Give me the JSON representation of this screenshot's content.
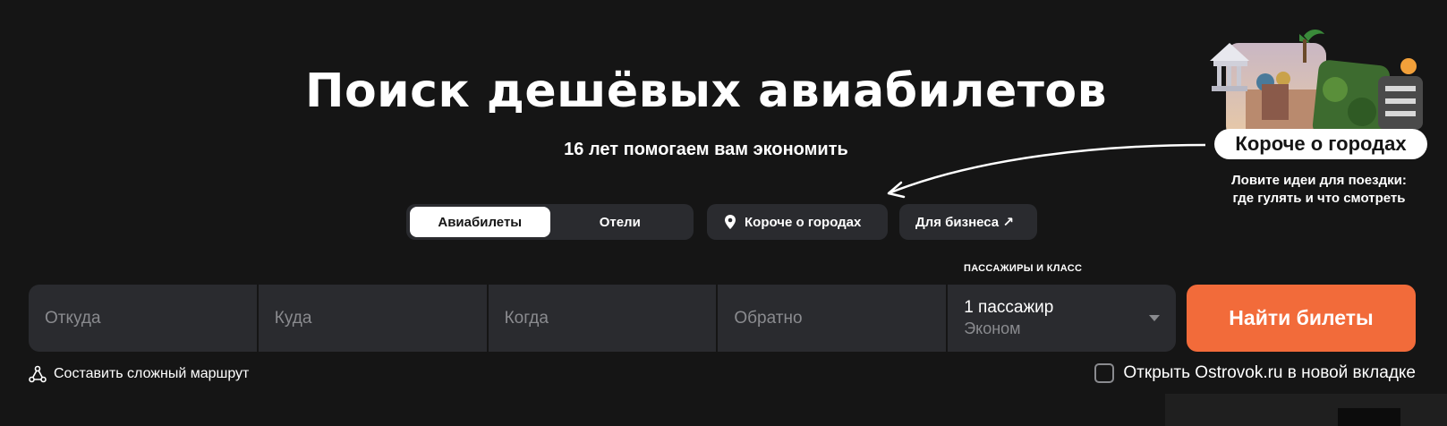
{
  "header": {
    "title": "Поиск дешёвых авиабилетов",
    "subtitle": "16 лет помогаем вам экономить"
  },
  "tabs": {
    "flights": "Авиабилеты",
    "hotels": "Отели",
    "active": "flights"
  },
  "quick_links": {
    "cities": "Короче о городах",
    "business": "Для бизнеса ↗"
  },
  "search": {
    "from_placeholder": "Откуда",
    "to_placeholder": "Куда",
    "when_placeholder": "Когда",
    "back_placeholder": "Обратно",
    "passengers_label": "ПАССАЖИРЫ И КЛАСС",
    "passengers_value": "1 пассажир",
    "class_value": "Эконом",
    "submit_label": "Найти билеты"
  },
  "options": {
    "complex_route": "Составить сложный маршрут",
    "open_new_tab": "Открыть Ostrovok.ru в новой вкладке"
  },
  "promo": {
    "chip": "Короче о городах",
    "line1": "Ловите идеи для поездки:",
    "line2": "где гулять и что смотреть"
  },
  "colors": {
    "background": "#151515",
    "field": "#2a2b2f",
    "accent": "#f26b3a"
  }
}
